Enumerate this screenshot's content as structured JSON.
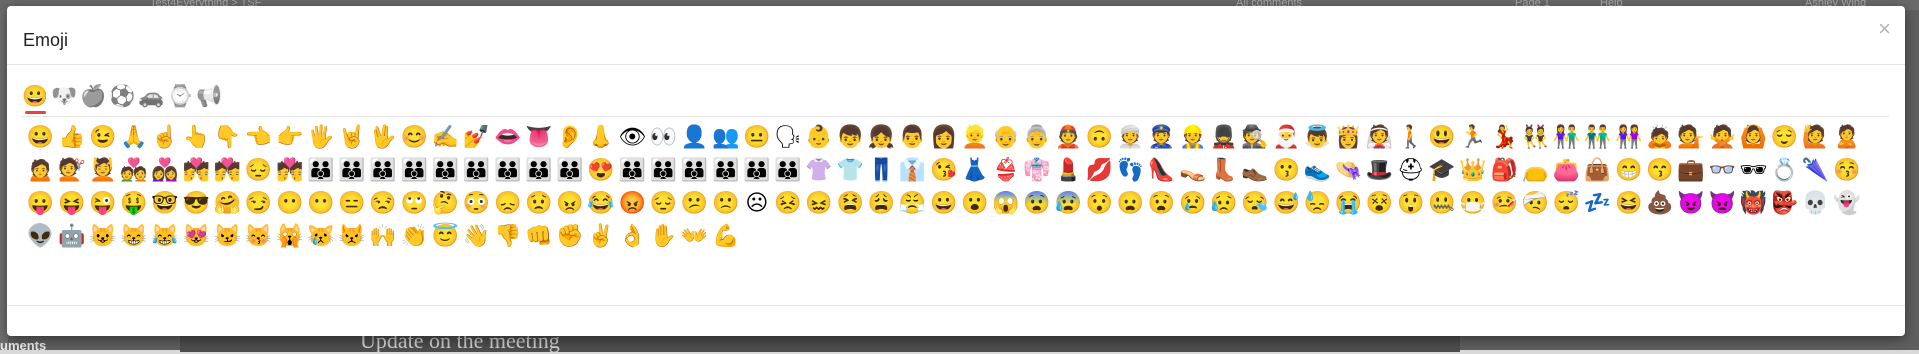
{
  "background": {
    "crumbs": "Test4Everything  >  TSF",
    "comments": "All comments",
    "page": "Page 1",
    "help": "Help",
    "user": "Ashley Wing",
    "bottom_text": "Update on the meeting",
    "bottom_left": "uments"
  },
  "modal": {
    "title": "Emoji",
    "close_label": "×"
  },
  "tabs": [
    {
      "name": "smileys",
      "glyph": "😀"
    },
    {
      "name": "animals",
      "glyph": "🐶"
    },
    {
      "name": "food",
      "glyph": "🍎"
    },
    {
      "name": "activity",
      "glyph": "⚽"
    },
    {
      "name": "travel",
      "glyph": "🚗"
    },
    {
      "name": "objects",
      "glyph": "⌚"
    },
    {
      "name": "symbols",
      "glyph": "📢"
    }
  ],
  "emojis": [
    "😀",
    "👍",
    "😉",
    "🙏",
    "☝",
    "👆",
    "👇",
    "👈",
    "👉",
    "🖐",
    "🤘",
    "🖖",
    "😊",
    "✍",
    "💅",
    "👄",
    "👅",
    "👂",
    "👃",
    "👁",
    "👀",
    "👤",
    "👥",
    "😐",
    "🗣",
    "👶",
    "👦",
    "👧",
    "👨",
    "👩",
    "👱",
    "👴",
    "👵",
    "👲",
    "🙃",
    "👳",
    "👮",
    "👷",
    "💂",
    "🕵",
    "🎅",
    "👼",
    "👸",
    "👰",
    "🚶",
    "😃",
    "🏃",
    "💃",
    "👯",
    "👫",
    "👬",
    "👭",
    "🙇",
    "💁",
    "🙅",
    "🙆",
    "😌",
    "🙋",
    "🙎",
    "🙍",
    "💇",
    "💆",
    "💑",
    "👩‍❤️‍👩",
    "💏",
    "💏",
    "😔",
    "💏",
    "👪",
    "👪",
    "👪",
    "👪",
    "👪",
    "👪",
    "👪",
    "👪",
    "👪",
    "😍",
    "👪",
    "👪",
    "👪",
    "👪",
    "👪",
    "👪",
    "👚",
    "👕",
    "👖",
    "👔",
    "😘",
    "👗",
    "👙",
    "👘",
    "💄",
    "💋",
    "👣",
    "👠",
    "👡",
    "👢",
    "👞",
    "😗",
    "👟",
    "👒",
    "🎩",
    "⛑",
    "🎓",
    "👑",
    "🎒",
    "👝",
    "👛",
    "👜",
    "😁",
    "😙",
    "💼",
    "👓",
    "🕶",
    "💍",
    "🌂",
    "😚",
    "😛",
    "😝",
    "😜",
    "🤑",
    "🤓",
    "😎",
    "🤗",
    "😏",
    "😶",
    "😶",
    "😑",
    "😒",
    "🙄",
    "🤔",
    "😳",
    "😞",
    "😟",
    "😠",
    "😂",
    "😡",
    "😔",
    "😕",
    "🙁",
    "☹",
    "😣",
    "😖",
    "😫",
    "😩",
    "😤",
    "😀",
    "😮",
    "😱",
    "😨",
    "😰",
    "😯",
    "😦",
    "😧",
    "😢",
    "😥",
    "😪",
    "😅",
    "😓",
    "😭",
    "😵",
    "😲",
    "🤐",
    "😷",
    "🤒",
    "🤕",
    "😴",
    "💤",
    "😆",
    "💩",
    "😈",
    "👿",
    "👹",
    "👺",
    "💀",
    "👻",
    "👽",
    "🤖",
    "😺",
    "😸",
    "😹",
    "😻",
    "😼",
    "😽",
    "🙀",
    "😿",
    "😾",
    "🙌",
    "👏",
    "😇",
    "👋",
    "👎",
    "👊",
    "✊",
    "✌",
    "👌",
    "✋",
    "👐",
    "💪"
  ]
}
